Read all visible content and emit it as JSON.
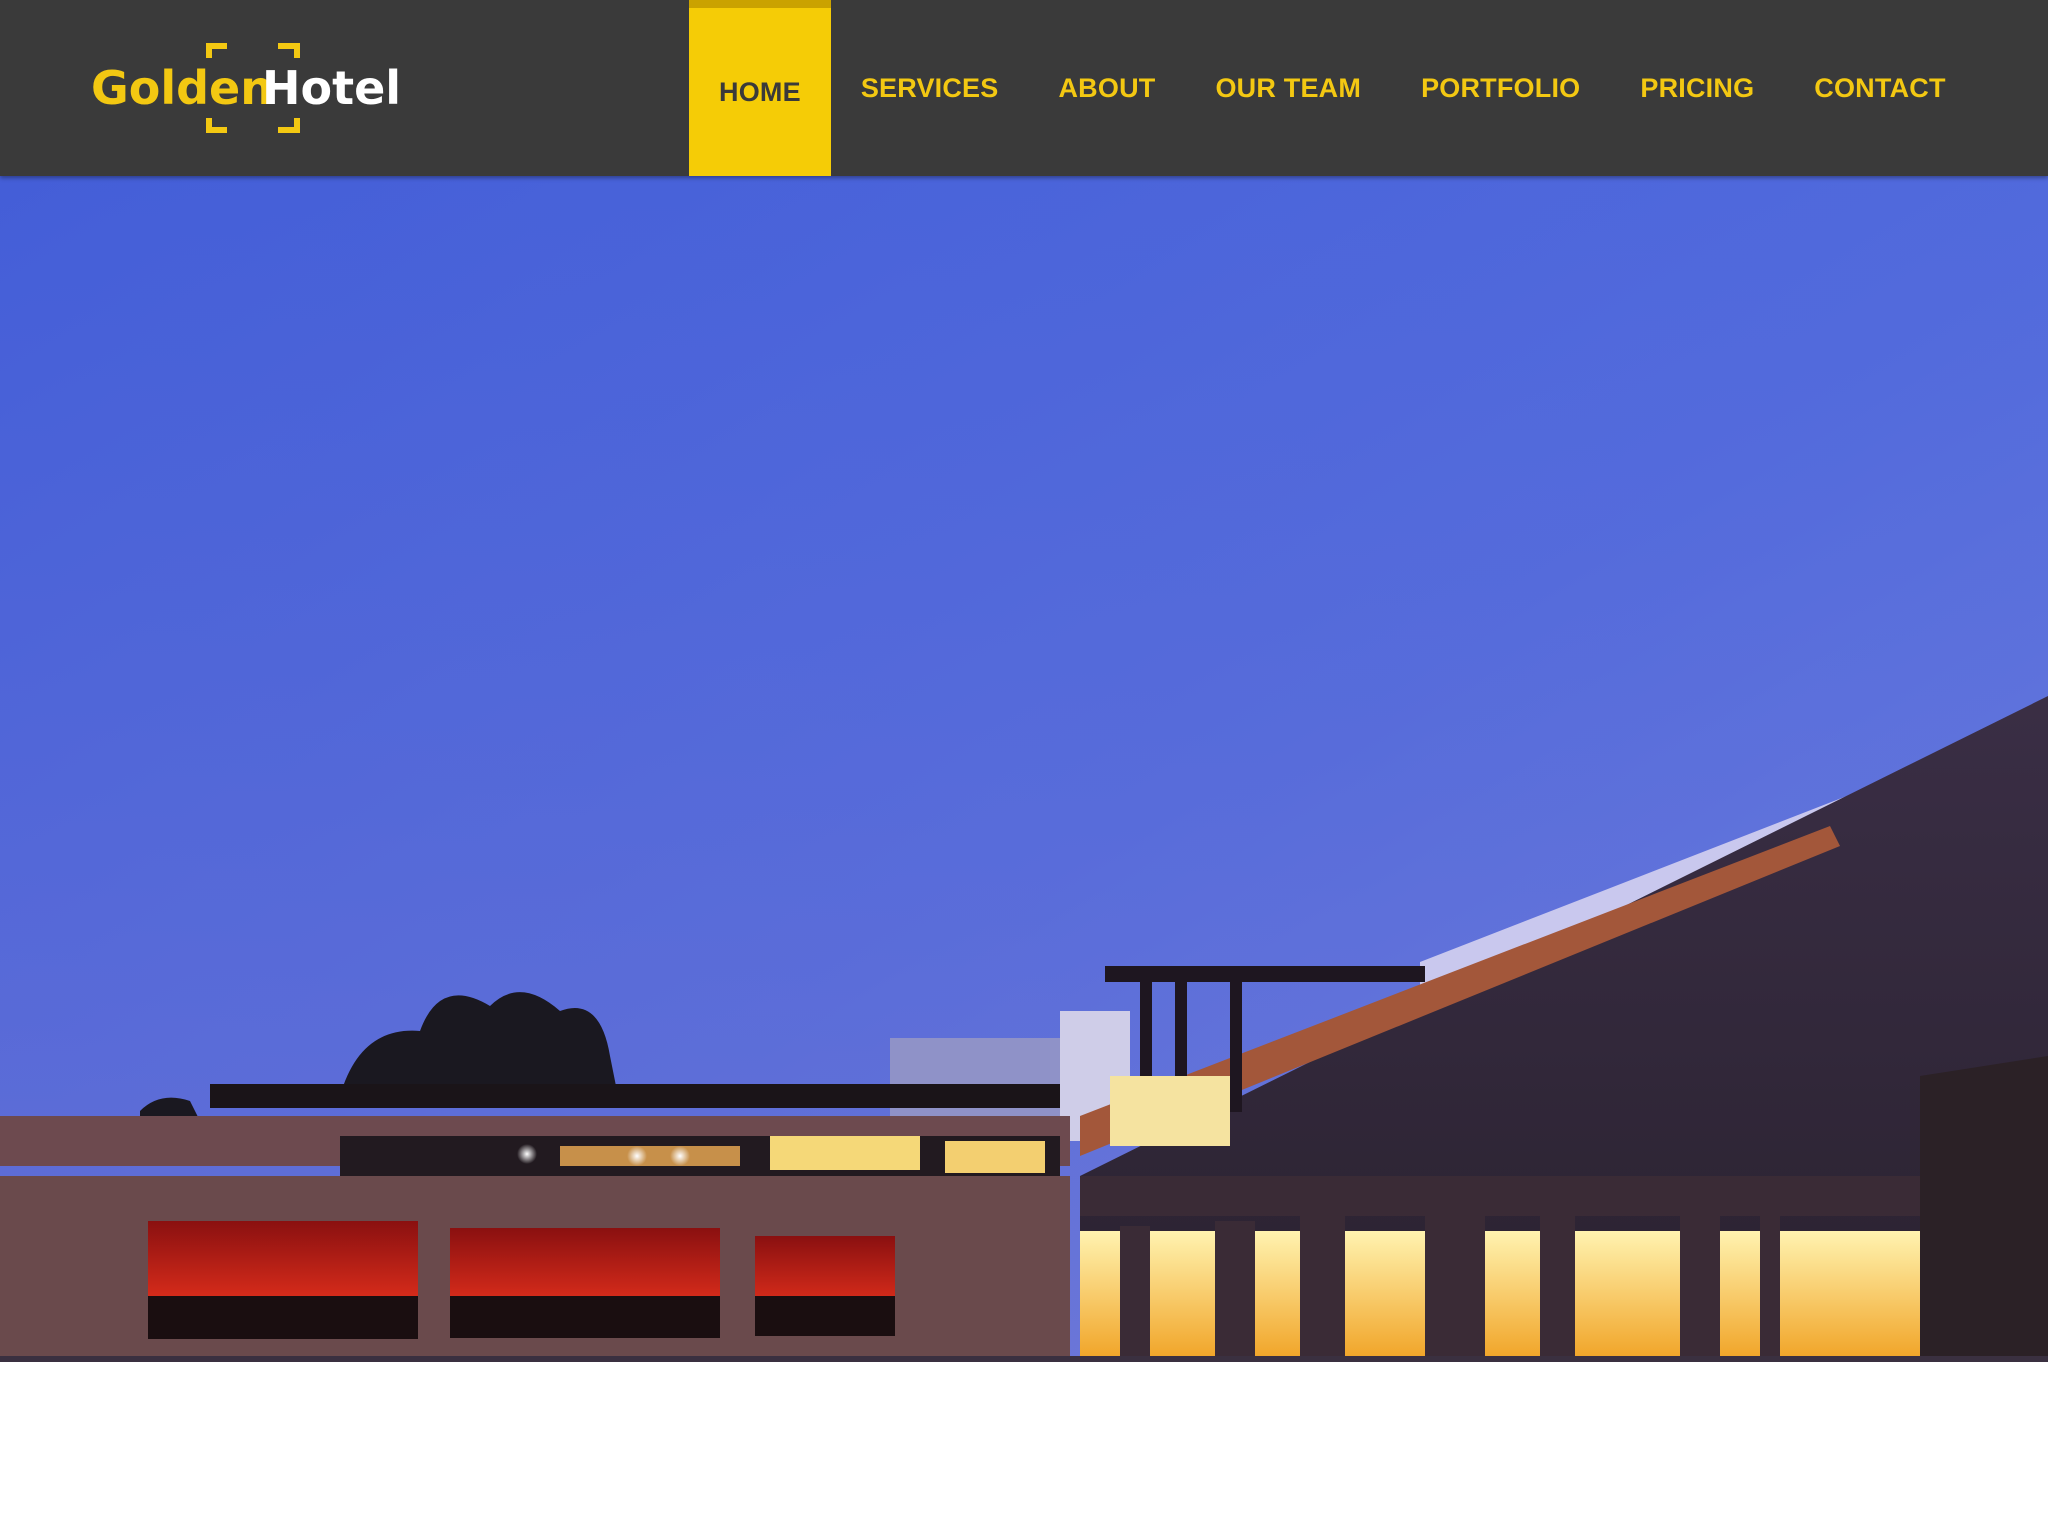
{
  "brand": {
    "name_part1": "Golden",
    "name_part2": "Hotel"
  },
  "nav": {
    "items": [
      {
        "label": "HOME",
        "active": true
      },
      {
        "label": "SERVICES",
        "active": false
      },
      {
        "label": "ABOUT",
        "active": false
      },
      {
        "label": "OUR TEAM",
        "active": false
      },
      {
        "label": "PORTFOLIO",
        "active": false
      },
      {
        "label": "PRICING",
        "active": false
      },
      {
        "label": "CONTACT",
        "active": false
      }
    ]
  },
  "hero": {
    "image": "hotel-exterior-at-dusk"
  },
  "colors": {
    "navbar_bg": "#3a3a3a",
    "accent": "#f5cc06",
    "link": "#f3c812"
  }
}
